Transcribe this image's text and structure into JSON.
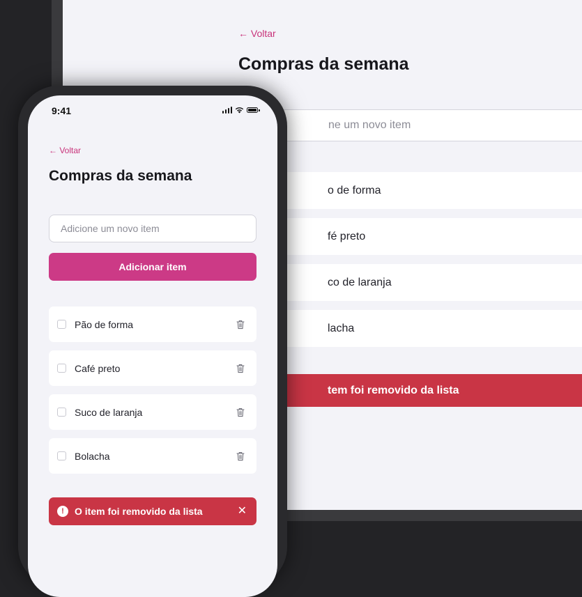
{
  "tablet": {
    "back_label": "← Voltar",
    "title": "Compras da semana",
    "input_placeholder_visible": "ne um novo item",
    "items_visible": [
      "o de forma",
      "fé preto",
      "co de laranja",
      "lacha"
    ],
    "toast_visible": "tem foi removido da lista"
  },
  "phone": {
    "status": {
      "time": "9:41"
    },
    "back_label": "← Voltar",
    "title": "Compras da semana",
    "input": {
      "placeholder": "Adicione um novo item",
      "value": ""
    },
    "add_button": "Adicionar item",
    "items": [
      {
        "label": "Pão de forma",
        "checked": false
      },
      {
        "label": "Café preto",
        "checked": false
      },
      {
        "label": "Suco de laranja",
        "checked": false
      },
      {
        "label": "Bolacha",
        "checked": false
      }
    ],
    "toast": {
      "message": "O item foi removido da lista",
      "close": "✕",
      "alert_glyph": "!"
    }
  },
  "colors": {
    "accent": "#cc3a86",
    "danger": "#c93545",
    "background": "#f3f3f8"
  }
}
